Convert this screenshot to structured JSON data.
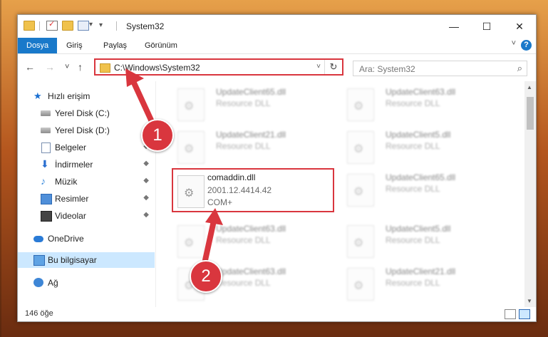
{
  "window": {
    "title": "System32",
    "minimize_glyph": "—",
    "maximize_glyph": "☐",
    "close_glyph": "✕",
    "qat_dropdown_glyph": "▾"
  },
  "ribbon": {
    "tabs": [
      "Dosya",
      "Giriş",
      "Paylaş",
      "Görünüm"
    ],
    "collapse_glyph": "˅",
    "help_glyph": "?"
  },
  "nav": {
    "back_glyph": "←",
    "forward_glyph": "→",
    "recent_glyph": "˅",
    "up_glyph": "↑",
    "address": "C:\\Windows\\System32",
    "address_dropdown_glyph": "˅",
    "refresh_glyph": "↻",
    "search_placeholder": "Ara: System32",
    "search_glyph": "⌕"
  },
  "sidebar": {
    "items": [
      {
        "label": "Hızlı erişim",
        "icon": "star-icon"
      },
      {
        "label": "Yerel Disk (C:)",
        "icon": "disk-icon"
      },
      {
        "label": "Yerel Disk (D:)",
        "icon": "disk-icon"
      },
      {
        "label": "Belgeler",
        "icon": "documents-icon"
      },
      {
        "label": "İndirmeler",
        "icon": "download-icon"
      },
      {
        "label": "Müzik",
        "icon": "music-icon"
      },
      {
        "label": "Resimler",
        "icon": "pictures-icon"
      },
      {
        "label": "Videolar",
        "icon": "videos-icon"
      },
      {
        "label": "OneDrive",
        "icon": "onedrive-icon"
      },
      {
        "label": "Bu bilgisayar",
        "icon": "this-pc-icon"
      },
      {
        "label": "Ağ",
        "icon": "network-icon"
      }
    ],
    "pin_glyph": "📌"
  },
  "files": [
    {
      "name": "UpdateClient65.dll",
      "type": "Resource DLL"
    },
    {
      "name": "UpdateClient63.dll",
      "type": "Resource DLL"
    },
    {
      "name": "UpdateClient21.dll",
      "type": "Resource DLL"
    },
    {
      "name": "UpdateClient5.dll",
      "type": "Resource DLL"
    },
    {
      "name": "comaddin.dll",
      "version": "2001.12.4414.42",
      "type": "COM+"
    },
    {
      "name": "UpdateClient65.dll",
      "type": "Resource DLL"
    },
    {
      "name": "UpdateClient63.dll",
      "type": "Resource DLL"
    },
    {
      "name": "UpdateClient5.dll",
      "type": "Resource DLL"
    },
    {
      "name": "UpdateClient63.dll",
      "type": "Resource DLL"
    },
    {
      "name": "UpdateClient21.dll",
      "type": "Resource DLL"
    }
  ],
  "status": {
    "item_count": "146 öğe"
  },
  "annotations": {
    "badge1": "1",
    "badge2": "2",
    "color": "#d9363e"
  }
}
